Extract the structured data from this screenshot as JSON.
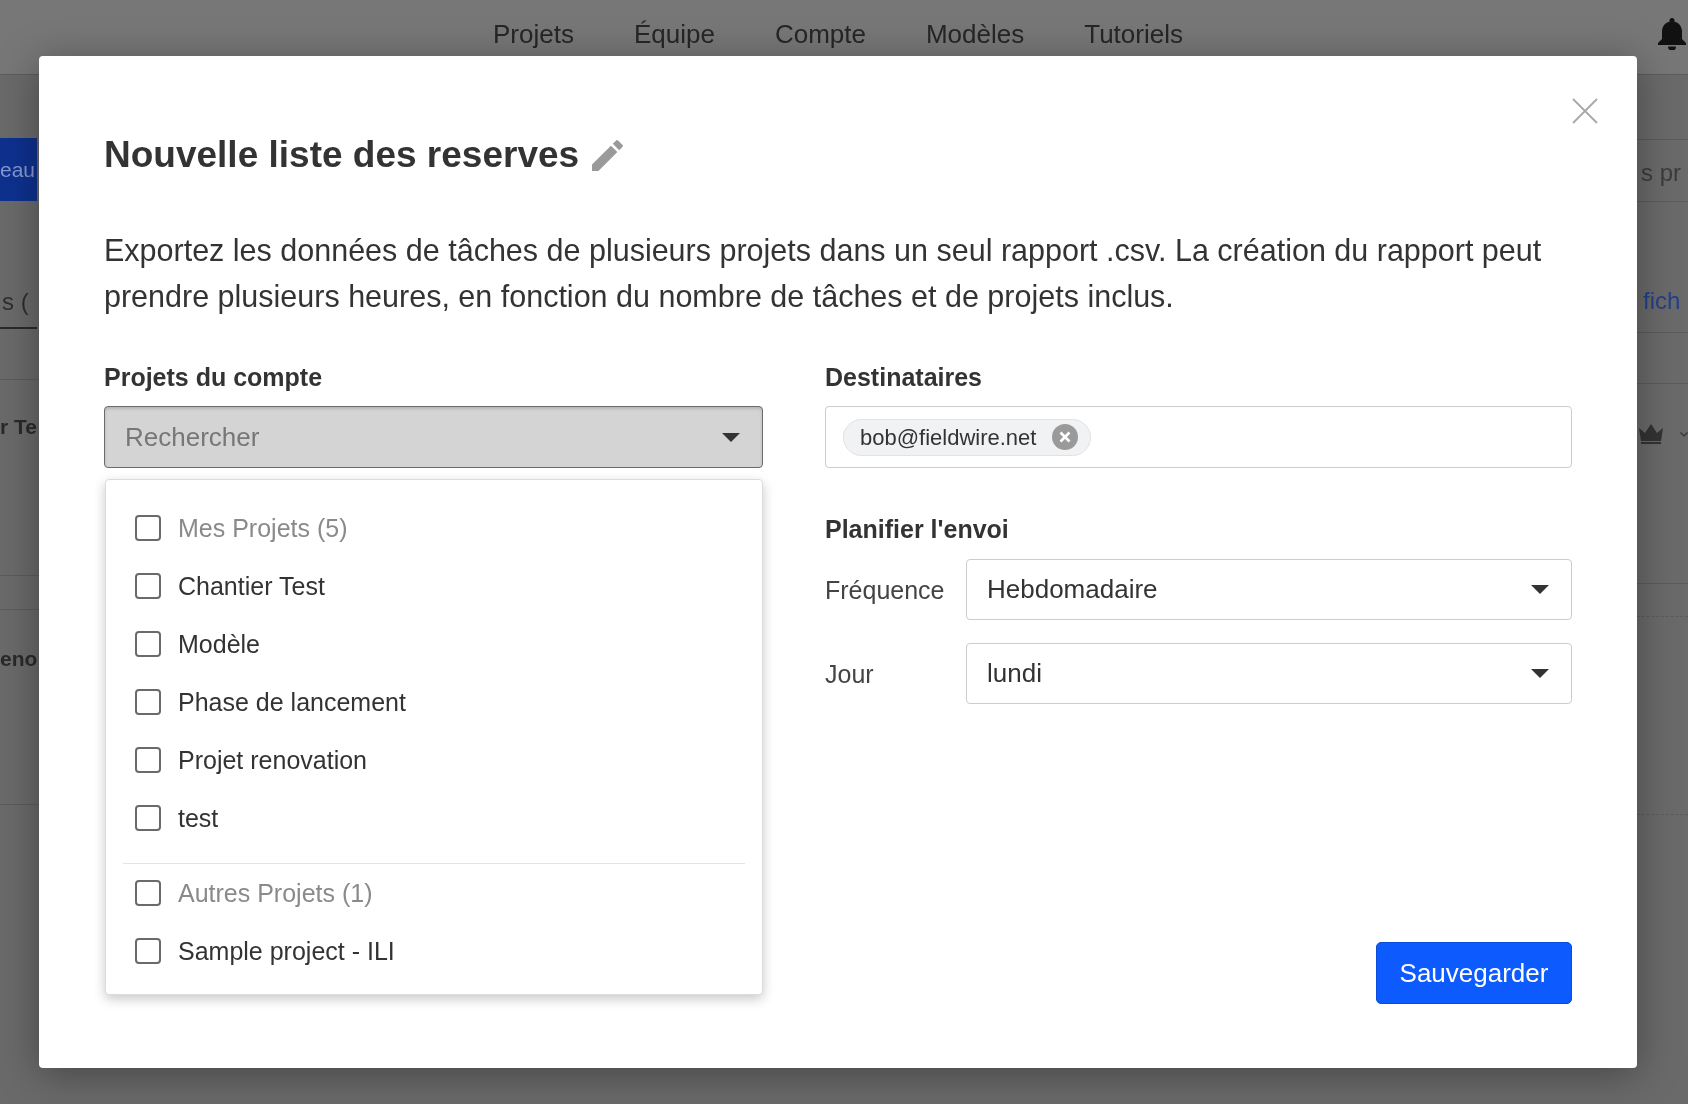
{
  "top_nav": {
    "items": [
      "Projets",
      "Équipe",
      "Compte",
      "Modèles",
      "Tutoriels"
    ]
  },
  "background_left": {
    "button": "eau",
    "tab": {
      "label": "s (",
      "selected": true
    },
    "rows": [
      "r Te",
      "eno"
    ]
  },
  "background_right": {
    "heading": "s pr",
    "link": "fich"
  },
  "dialog": {
    "title": "Nouvelle liste des reserves",
    "description": "Exportez les données de tâches de plusieurs projets dans un seul rapport .csv. La création du rapport peut prendre plusieurs heures, en fonction du nombre de tâches et de projets inclus.",
    "projects": {
      "label": "Projets du compte",
      "placeholder": "Rechercher",
      "expanded": true,
      "groups": [
        {
          "label": "Mes Projets (5)",
          "checked": false,
          "items": [
            {
              "label": "Chantier Test",
              "checked": false
            },
            {
              "label": "Modèle",
              "checked": false
            },
            {
              "label": "Phase de lancement",
              "checked": false
            },
            {
              "label": "Projet renovation",
              "checked": false
            },
            {
              "label": "test",
              "checked": false
            }
          ]
        },
        {
          "label": "Autres Projets (1)",
          "checked": false,
          "items": [
            {
              "label": "Sample project - ILI",
              "checked": false
            }
          ]
        }
      ]
    },
    "recipients": {
      "label": "Destinataires",
      "chips": [
        "bob@fieldwire.net"
      ]
    },
    "schedule": {
      "label": "Planifier l'envoi",
      "fields": [
        {
          "label": "Fréquence",
          "value": "Hebdomadaire"
        },
        {
          "label": "Jour",
          "value": "lundi"
        }
      ]
    },
    "save_button": "Sauvegarder"
  }
}
